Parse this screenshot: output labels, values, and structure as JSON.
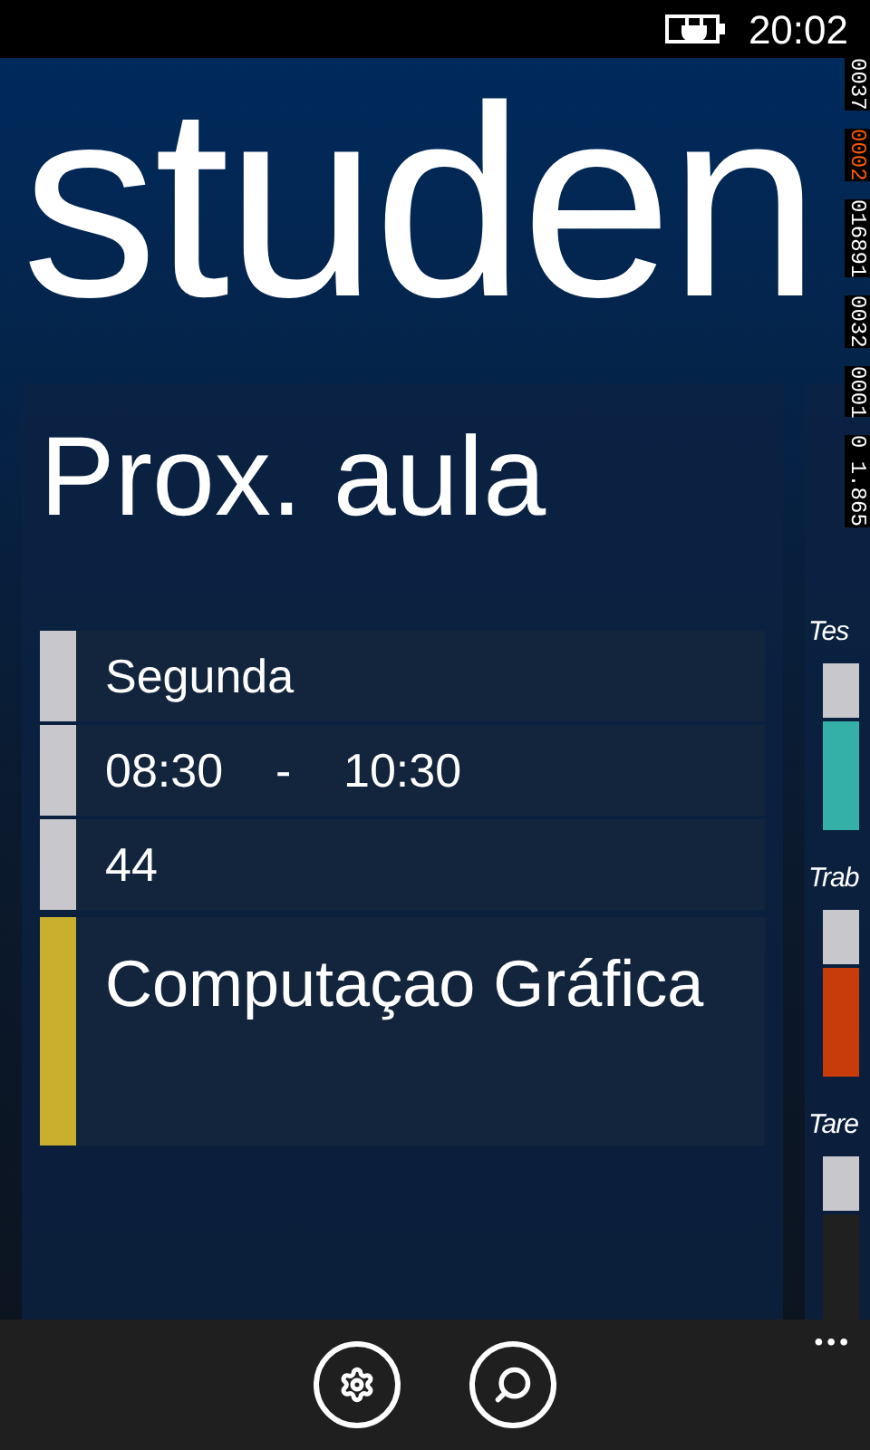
{
  "status_bar": {
    "time": "20:02",
    "charging": true
  },
  "title": "studen",
  "next_class": {
    "heading": "Prox. aula",
    "rows": [
      {
        "text": "Segunda",
        "color": "#c8c8cc"
      },
      {
        "text": "08:30    -    10:30",
        "color": "#c8c8cc"
      },
      {
        "text": "44",
        "color": "#c8c8cc"
      },
      {
        "text": "Computaçao Gráfica",
        "color": "#c8b02e",
        "kind": "large"
      }
    ]
  },
  "side_panel": {
    "groups": [
      {
        "label": "Tes",
        "color": "#35b0a8"
      },
      {
        "label": "Trab",
        "color": "#c83c0c"
      },
      {
        "label": "Tare",
        "color": "#202020"
      }
    ]
  },
  "debug_counters": [
    {
      "text": "0037",
      "highlighted": false
    },
    {
      "text": "0002",
      "highlighted": true
    },
    {
      "text": "016891",
      "highlighted": false
    },
    {
      "text": "0032",
      "highlighted": false
    },
    {
      "text": "0001",
      "highlighted": false
    },
    {
      "text": "0 1.865",
      "highlighted": false
    }
  ],
  "app_bar": {
    "buttons": [
      {
        "kind": "settings"
      },
      {
        "kind": "search"
      }
    ],
    "more": "•••"
  }
}
